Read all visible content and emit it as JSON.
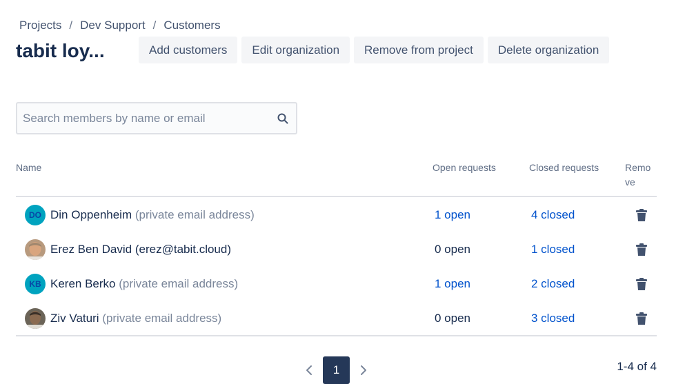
{
  "breadcrumb": {
    "items": [
      "Projects",
      "Dev Support",
      "Customers"
    ],
    "separator": "/"
  },
  "page_title": "tabit loy...",
  "actions": {
    "add_customers": "Add customers",
    "edit_organization": "Edit organization",
    "remove_from_project": "Remove from project",
    "delete_organization": "Delete organization"
  },
  "search": {
    "placeholder": "Search members by name or email",
    "value": "",
    "icon": "search-icon"
  },
  "table": {
    "headers": {
      "name": "Name",
      "open": "Open requests",
      "closed": "Closed requests",
      "remove_line1": "Remo",
      "remove_line2": "ve"
    },
    "rows": [
      {
        "avatar_type": "initials",
        "avatar_initials": "DO",
        "name": "Din Oppenheim",
        "email": "(private email address)",
        "open": "1 open",
        "open_is_link": true,
        "closed": "4 closed",
        "closed_is_link": true,
        "remove_icon": "trash-icon"
      },
      {
        "avatar_type": "photo",
        "avatar_initials": "",
        "name": "Erez Ben David",
        "email": "(erez@tabit.cloud)",
        "open": "0 open",
        "open_is_link": false,
        "closed": "1 closed",
        "closed_is_link": true,
        "remove_icon": "trash-icon"
      },
      {
        "avatar_type": "initials",
        "avatar_initials": "KB",
        "name": "Keren Berko",
        "email": "(private email address)",
        "open": "1 open",
        "open_is_link": true,
        "closed": "2 closed",
        "closed_is_link": true,
        "remove_icon": "trash-icon"
      },
      {
        "avatar_type": "photo",
        "avatar_initials": "",
        "name": "Ziv Vaturi",
        "email": "(private email address)",
        "open": "0 open",
        "open_is_link": false,
        "closed": "3 closed",
        "closed_is_link": true,
        "remove_icon": "trash-icon"
      }
    ]
  },
  "pagination": {
    "current_page": "1",
    "range": "1-4 of 4"
  },
  "colors": {
    "link": "#0052cc",
    "avatar_initials_bg": "#00a3bf",
    "active_page_bg": "#253858",
    "button_bg": "#f4f5f7"
  }
}
